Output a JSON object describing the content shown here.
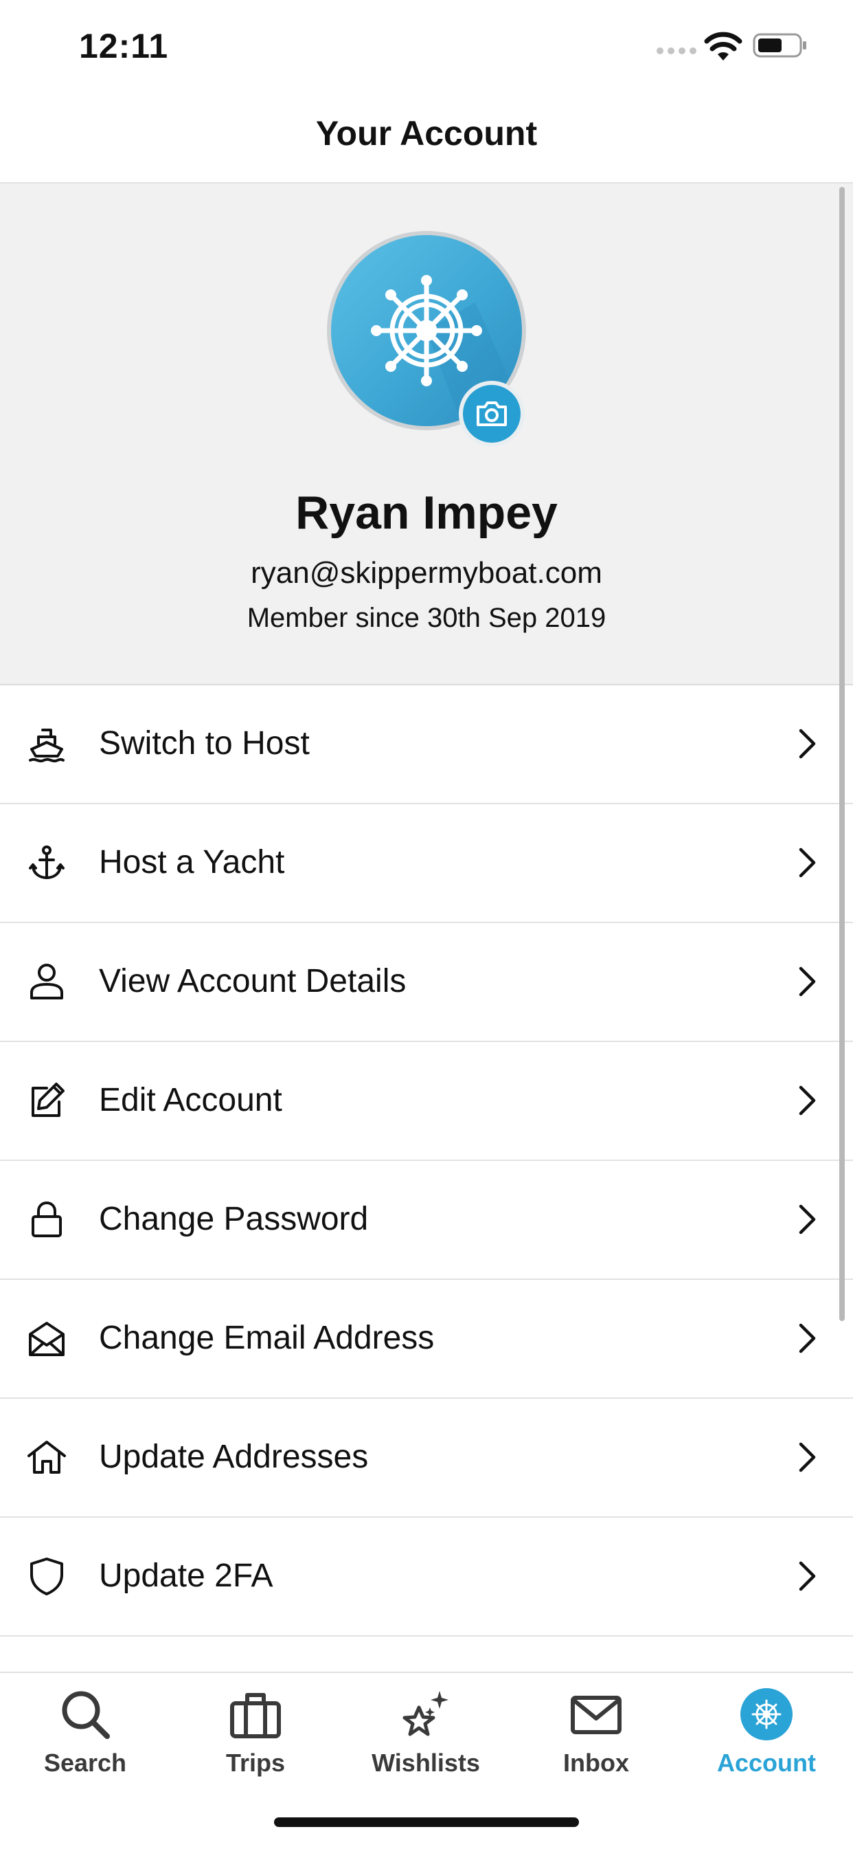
{
  "status_bar": {
    "time": "12:11"
  },
  "nav": {
    "title": "Your Account"
  },
  "profile": {
    "name": "Ryan Impey",
    "email": "ryan@skippermyboat.com",
    "member_since": "Member since 30th Sep 2019",
    "avatar_icon": "ship-wheel-icon",
    "camera_icon": "camera-icon"
  },
  "menu": [
    {
      "label": "Switch to Host",
      "icon": "ship-icon"
    },
    {
      "label": "Host a Yacht",
      "icon": "anchor-icon"
    },
    {
      "label": "View Account Details",
      "icon": "user-icon"
    },
    {
      "label": "Edit Account",
      "icon": "edit-icon"
    },
    {
      "label": "Change Password",
      "icon": "lock-icon"
    },
    {
      "label": "Change Email Address",
      "icon": "envelope-open-icon"
    },
    {
      "label": "Update Addresses",
      "icon": "home-icon"
    },
    {
      "label": "Update 2FA",
      "icon": "shield-icon"
    }
  ],
  "tabs": [
    {
      "label": "Search",
      "icon": "search-icon",
      "active": false
    },
    {
      "label": "Trips",
      "icon": "briefcase-icon",
      "active": false
    },
    {
      "label": "Wishlists",
      "icon": "star-sparkle-icon",
      "active": false
    },
    {
      "label": "Inbox",
      "icon": "envelope-icon",
      "active": false
    },
    {
      "label": "Account",
      "icon": "ship-wheel-icon",
      "active": true
    }
  ],
  "colors": {
    "accent": "#2aa3d6",
    "profile_bg": "#f1f1f1",
    "divider": "#e2e2e2",
    "text": "#111111"
  }
}
